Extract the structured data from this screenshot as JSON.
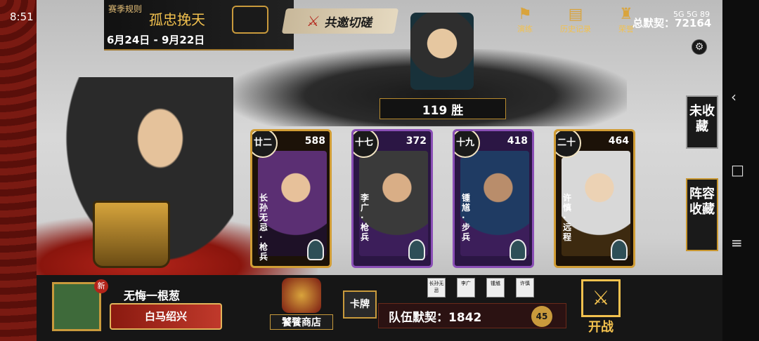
{
  "status": {
    "time": "8:51",
    "indicators": "5G  5G  89"
  },
  "season": {
    "rule_label": "赛季规则",
    "title": "孤忠挽天",
    "date_range": "6月24日 - 9月22日"
  },
  "invite_button": {
    "label": "共邀切磋",
    "icon": "crossed-swords-icon"
  },
  "top_menu": [
    {
      "label": "演练",
      "icon": "drill-icon"
    },
    {
      "label": "历史记录",
      "icon": "scroll-icon"
    },
    {
      "label": "荣誉",
      "icon": "honor-icon"
    }
  ],
  "tacit_total": {
    "label": "总默契：",
    "value": "72164"
  },
  "opponent": {
    "wins": "119 胜"
  },
  "cards": [
    {
      "rank": "廿二",
      "power": "588",
      "name": "长孙无忌·枪兵",
      "frame": "gold"
    },
    {
      "rank": "十七",
      "power": "372",
      "name": "李广·枪兵",
      "frame": "purple"
    },
    {
      "rank": "十九",
      "power": "418",
      "name": "锺馗·步兵",
      "frame": "purple"
    },
    {
      "rank": "二十",
      "power": "464",
      "name": "许慎·远程",
      "frame": "gold"
    }
  ],
  "side_tabs": {
    "uncollected": "未收藏",
    "lineup_collection": "阵容收藏"
  },
  "player": {
    "new_tag": "新",
    "name": "无悔一根葱",
    "title_badge": "白马绍兴"
  },
  "shop": {
    "label": "饕餮商店"
  },
  "cards_button": {
    "label": "卡牌"
  },
  "mini_generals": [
    {
      "label": "长孙无忌"
    },
    {
      "label": "李广"
    },
    {
      "label": "锺馗"
    },
    {
      "label": "许慎"
    }
  ],
  "team_tacit": {
    "label": "队伍默契：1842",
    "level": "45"
  },
  "start_button": {
    "label": "开战"
  },
  "colors": {
    "gold": "#f2c14e",
    "purple_frame": "#8a4fb6",
    "red": "#b3241a"
  }
}
